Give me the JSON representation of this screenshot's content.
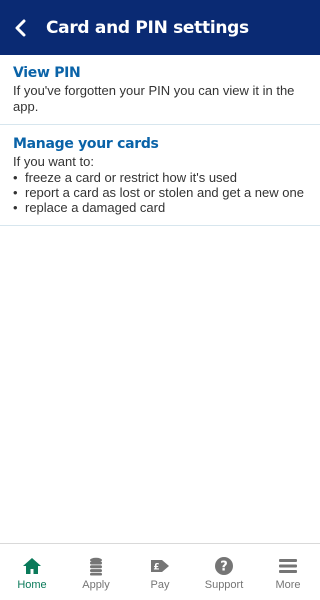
{
  "header": {
    "back_icon": "chevron-left-icon",
    "title": "Card and PIN settings"
  },
  "sections": [
    {
      "title": "View PIN",
      "description": "If you've forgotten your PIN you can view it in the app."
    },
    {
      "title": "Manage your cards",
      "intro": "If you want to:",
      "bullets": [
        "freeze a card or restrict how it's used",
        "report a card as lost or stolen and get a new one",
        "replace a damaged card"
      ]
    }
  ],
  "tabbar": {
    "active": "Home",
    "active_color": "#0a7a5a",
    "items": [
      {
        "label": "Home",
        "icon": "home-icon"
      },
      {
        "label": "Apply",
        "icon": "coins-stack-icon"
      },
      {
        "label": "Pay",
        "icon": "pay-pound-arrow-icon"
      },
      {
        "label": "Support",
        "icon": "question-circle-icon"
      },
      {
        "label": "More",
        "icon": "hamburger-menu-icon"
      }
    ]
  },
  "colors": {
    "header_bg": "#0a2a73",
    "section_title": "#0a63a8",
    "divider": "#d7e6ee"
  }
}
